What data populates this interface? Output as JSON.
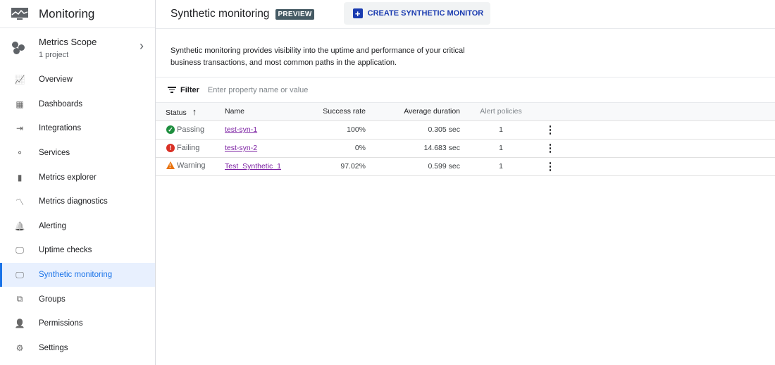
{
  "app": {
    "title": "Monitoring"
  },
  "scope": {
    "title": "Metrics Scope",
    "subtitle": "1 project"
  },
  "nav": [
    {
      "label": "Overview",
      "icon": "overview-icon"
    },
    {
      "label": "Dashboards",
      "icon": "dashboards-icon"
    },
    {
      "label": "Integrations",
      "icon": "integrations-icon"
    },
    {
      "label": "Services",
      "icon": "services-icon"
    },
    {
      "label": "Metrics explorer",
      "icon": "bar-chart-icon"
    },
    {
      "label": "Metrics diagnostics",
      "icon": "diagnostics-icon"
    },
    {
      "label": "Alerting",
      "icon": "bell-icon"
    },
    {
      "label": "Uptime checks",
      "icon": "monitor-icon"
    },
    {
      "label": "Synthetic monitoring",
      "icon": "synthetic-icon",
      "active": true
    },
    {
      "label": "Groups",
      "icon": "groups-icon"
    },
    {
      "label": "Permissions",
      "icon": "person-icon"
    },
    {
      "label": "Settings",
      "icon": "gear-icon"
    }
  ],
  "header": {
    "title": "Synthetic monitoring",
    "badge": "PREVIEW",
    "create_label": "CREATE SYNTHETIC MONITOR"
  },
  "description": "Synthetic monitoring provides visibility into the uptime and performance of your critical business transactions, and most common paths in the application.",
  "filter": {
    "label": "Filter",
    "placeholder": "Enter property name or value"
  },
  "table": {
    "columns": [
      "Status",
      "Name",
      "Success rate",
      "Average duration",
      "Alert policies"
    ],
    "rows": [
      {
        "status": "Passing",
        "name": "test-syn-1",
        "success": "100%",
        "duration": "0.305 sec",
        "alerts": "1"
      },
      {
        "status": "Failing",
        "name": "test-syn-2",
        "success": "0%",
        "duration": "14.683 sec",
        "alerts": "1"
      },
      {
        "status": "Warning",
        "name": "Test_Synthetic_1",
        "success": "97.02%",
        "duration": "0.599 sec",
        "alerts": "1"
      }
    ]
  },
  "colors": {
    "accent": "#1a73e8",
    "passing": "#1e8e3e",
    "failing": "#d93025",
    "warning": "#e8710a",
    "link": "#7b1fa2"
  }
}
